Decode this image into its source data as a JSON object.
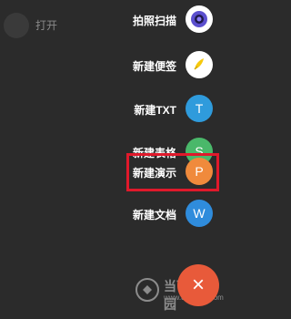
{
  "top": {
    "open_label": "打开"
  },
  "menu": [
    {
      "label": "拍照扫描",
      "icon": "camera-scan-icon",
      "color": "#ffffff"
    },
    {
      "label": "新建便签",
      "icon": "note-icon",
      "color": "#f6c90e"
    },
    {
      "label": "新建TXT",
      "icon": "txt-icon",
      "glyph": "T",
      "color": "#2f9bdc"
    },
    {
      "label": "新建表格",
      "icon": "spreadsheet-icon",
      "glyph": "S",
      "color": "#4ab86a"
    },
    {
      "label": "新建演示",
      "icon": "presentation-icon",
      "glyph": "P",
      "color": "#f08a3c"
    },
    {
      "label": "新建文档",
      "icon": "document-icon",
      "glyph": "W",
      "color": "#2f8cdc"
    }
  ],
  "fab": {
    "glyph": "×",
    "color": "#e85a3a"
  },
  "watermark": {
    "title": "当下软件园",
    "url": "www.downxia.com"
  },
  "highlight_color": "#e0192b"
}
